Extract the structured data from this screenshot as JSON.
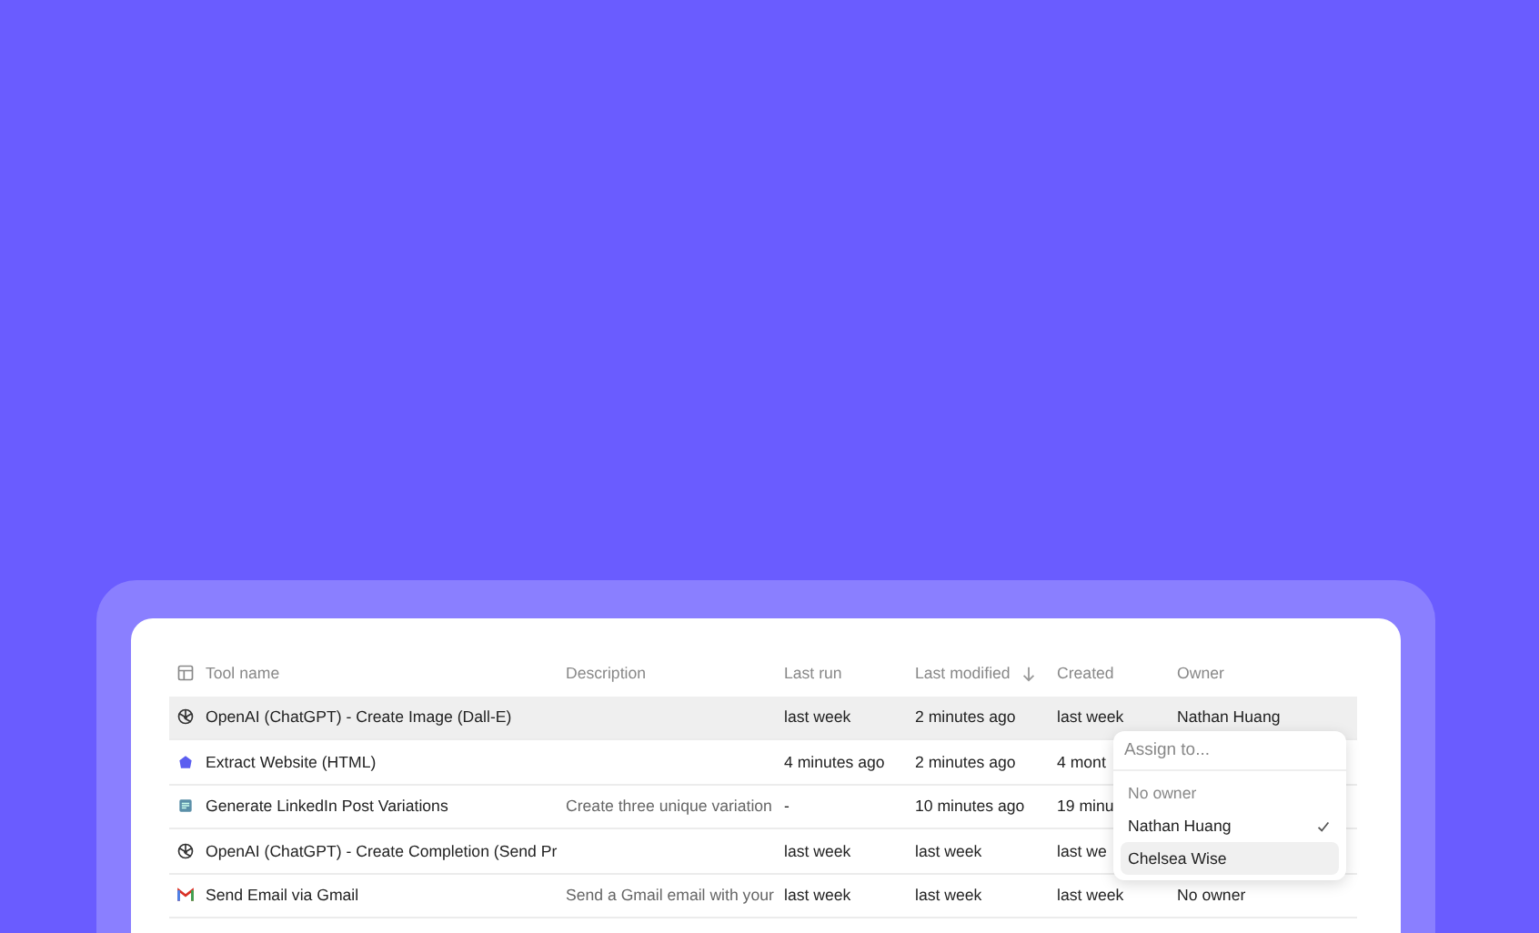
{
  "table": {
    "columns": [
      {
        "label": "Tool name",
        "sorted": false
      },
      {
        "label": "Description",
        "sorted": false
      },
      {
        "label": "Last run",
        "sorted": false
      },
      {
        "label": "Last modified",
        "sorted": true
      },
      {
        "label": "Created",
        "sorted": false
      },
      {
        "label": "Owner",
        "sorted": false
      }
    ],
    "rows": [
      {
        "kind": "openai",
        "selected": true,
        "cells": [
          "OpenAI (ChatGPT) - Create Image (Dall-E)",
          "",
          "last week",
          "2 minutes ago",
          "last week",
          "Nathan Huang"
        ]
      },
      {
        "kind": "extract",
        "selected": false,
        "cells": [
          "Extract Website (HTML)",
          "",
          "4 minutes ago",
          "2 minutes ago",
          "4 mont",
          ""
        ]
      },
      {
        "kind": "doc",
        "selected": false,
        "cells": [
          "Generate LinkedIn Post Variations",
          "Create three unique variation",
          "-",
          "10 minutes ago",
          "19 minu",
          ""
        ]
      },
      {
        "kind": "openai",
        "selected": false,
        "cells": [
          "OpenAI (ChatGPT) - Create Completion (Send Pr",
          "",
          "last week",
          "last week",
          "last we",
          ""
        ]
      },
      {
        "kind": "gmail",
        "selected": false,
        "cells": [
          "Send Email via Gmail",
          "Send a Gmail email with your",
          "last week",
          "last week",
          "last week",
          "No owner"
        ]
      }
    ]
  },
  "owner_menu": {
    "placeholder": "Assign to...",
    "options": [
      {
        "label": "No owner",
        "kind": "none",
        "checked": false,
        "highlighted": false
      },
      {
        "label": "Nathan Huang",
        "kind": "person",
        "checked": true,
        "highlighted": false
      },
      {
        "label": "Chelsea Wise",
        "kind": "person",
        "checked": false,
        "highlighted": true
      }
    ]
  }
}
